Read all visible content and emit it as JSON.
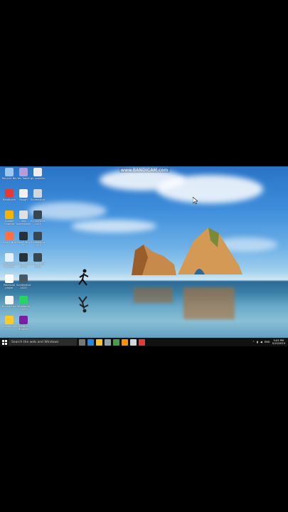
{
  "watermark": "www.BANDICAM.com",
  "desktop_icons": [
    {
      "label": "Recycle Bin",
      "icon": "recycle-bin-icon",
      "color": "#9cc7f2"
    },
    {
      "label": "Yes Tablet",
      "icon": "app-icon",
      "color": "#b39ddb"
    },
    {
      "label": "gh-installer",
      "icon": "file-icon",
      "color": "#eeeeee"
    },
    {
      "label": "Bandicam",
      "icon": "bandicam-icon",
      "color": "#e53935"
    },
    {
      "label": "Rough",
      "icon": "file-icon",
      "color": "#f2f2f2"
    },
    {
      "label": "Screenshot",
      "icon": "screenshot-icon",
      "color": "#cfd8dc"
    },
    {
      "label": "Google Chrome",
      "icon": "chrome-icon",
      "color": "#f4b400"
    },
    {
      "label": "img screenshot",
      "icon": "image-icon",
      "color": "#e0e0e0"
    },
    {
      "label": "Screenshot 2023",
      "icon": "screenshot-icon",
      "color": "#37474f"
    },
    {
      "label": "Sam Ultra",
      "icon": "app-icon",
      "color": "#ff7043"
    },
    {
      "label": "Sam Ultra FF",
      "icon": "screenshot-icon",
      "color": "#263238"
    },
    {
      "label": "Screenshot 2023",
      "icon": "screenshot-icon",
      "color": "#37474f"
    },
    {
      "label": "Pot Player Installer",
      "icon": "installer-icon",
      "color": "#e3f2fd"
    },
    {
      "label": "Screenshot 2023",
      "icon": "screenshot-icon",
      "color": "#263238"
    },
    {
      "label": "Screenshot 2023",
      "icon": "screenshot-icon",
      "color": "#37474f"
    },
    {
      "label": "Potencial player",
      "icon": "player-icon",
      "color": "#fff"
    },
    {
      "label": "Screenshot 2023",
      "icon": "screenshot-icon",
      "color": "#455a64"
    },
    {
      "label": "Bookmarks",
      "icon": "file-icon",
      "color": "#f5f5f5"
    },
    {
      "label": "Whatsapp 2023",
      "icon": "whatsapp-icon",
      "color": "#25d366"
    },
    {
      "label": "Accessibility",
      "icon": "accessibility-icon",
      "color": "#ffca28"
    },
    {
      "label": "Opera GX Browser",
      "icon": "opera-icon",
      "color": "#7b1fa2"
    }
  ],
  "taskbar": {
    "search_placeholder": "Search the web and Windows",
    "apps": [
      "task-view-icon",
      "edge-icon",
      "file-explorer-icon",
      "store-icon",
      "chrome-icon",
      "vlc-icon",
      "app-icon",
      "bandicam-icon"
    ],
    "language": "ENG",
    "time": "9:05 PM",
    "date": "5/15/2023"
  }
}
